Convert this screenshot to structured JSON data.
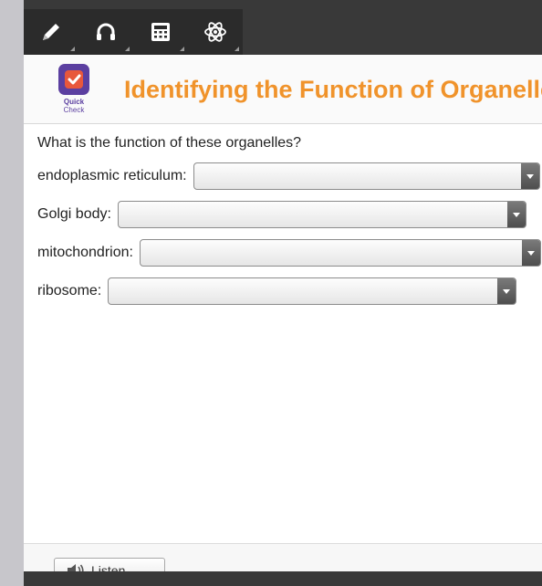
{
  "toolbar": {
    "tools": [
      {
        "icon": "pencil-icon"
      },
      {
        "icon": "headphones-icon"
      },
      {
        "icon": "calculator-icon"
      },
      {
        "icon": "atom-icon"
      }
    ]
  },
  "header": {
    "logo_line1": "Quick",
    "logo_line2": "Check",
    "title": "Identifying the Function of Organelles"
  },
  "question": {
    "prompt": "What is the function of these organelles?",
    "rows": [
      {
        "label": "endoplasmic reticulum:",
        "selected": ""
      },
      {
        "label": "Golgi body:",
        "selected": ""
      },
      {
        "label": "mitochondrion:",
        "selected": ""
      },
      {
        "label": "ribosome:",
        "selected": ""
      }
    ]
  },
  "footer": {
    "listen_label": "Listen"
  },
  "colors": {
    "title": "#f0932b",
    "logo": "#5b3fa0",
    "toolbar": "#2b2b2b"
  }
}
